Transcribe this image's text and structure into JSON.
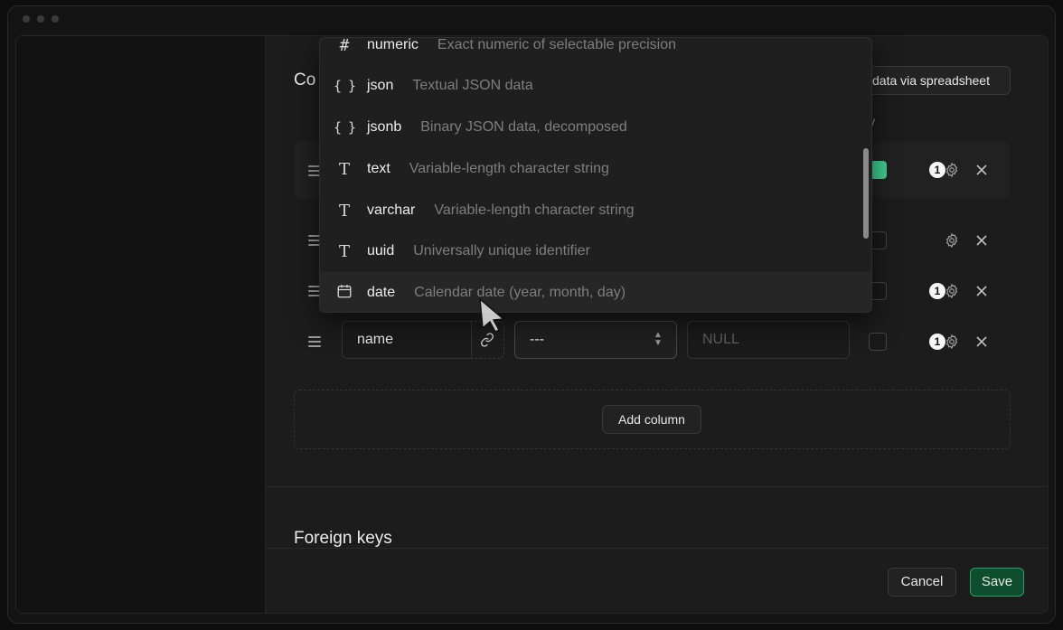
{
  "section": {
    "columns_title_partial": "Co",
    "import_button": "data via spreadsheet",
    "primary_header_partial": "imary",
    "foreign_keys_title": "Foreign keys"
  },
  "rows": [
    {
      "primary": true,
      "badge": "1"
    },
    {
      "primary": false,
      "badge": ""
    },
    {
      "primary": false,
      "badge": "1"
    },
    {
      "primary": false,
      "badge": "1",
      "name": "name",
      "type": "---",
      "default_placeholder": "NULL"
    }
  ],
  "add_column_label": "Add column",
  "footer": {
    "cancel": "Cancel",
    "save": "Save"
  },
  "type_options": [
    {
      "icon": "#",
      "icon_name": "hash-icon",
      "name": "numeric",
      "description": "Exact numeric of selectable precision"
    },
    {
      "icon": "{}",
      "icon_name": "braces-icon",
      "name": "json",
      "description": "Textual JSON data"
    },
    {
      "icon": "{}",
      "icon_name": "braces-icon",
      "name": "jsonb",
      "description": "Binary JSON data, decomposed"
    },
    {
      "icon": "T",
      "icon_name": "text-type-icon",
      "name": "text",
      "description": "Variable-length character string"
    },
    {
      "icon": "T",
      "icon_name": "text-type-icon",
      "name": "varchar",
      "description": "Variable-length character string"
    },
    {
      "icon": "T",
      "icon_name": "text-type-icon",
      "name": "uuid",
      "description": "Universally unique identifier"
    },
    {
      "icon": "cal",
      "icon_name": "calendar-icon",
      "name": "date",
      "description": "Calendar date (year, month, day)"
    }
  ],
  "colors": {
    "accent": "#3ecf8e",
    "save_bg": "#0f4d2f"
  }
}
